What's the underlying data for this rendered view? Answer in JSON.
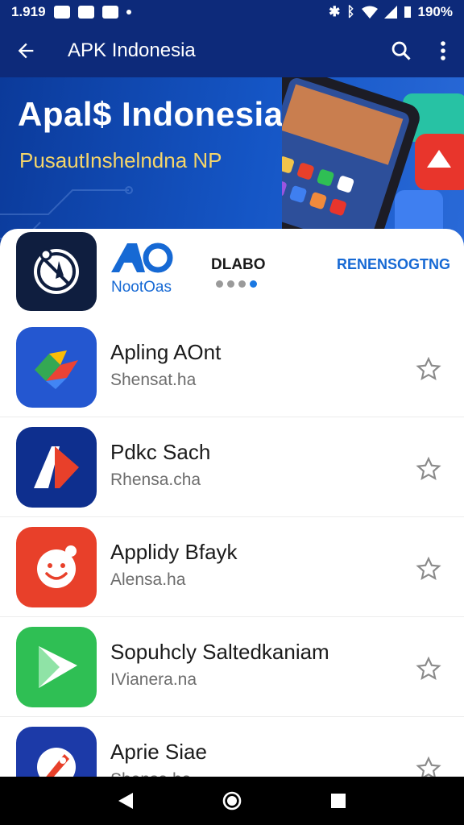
{
  "status_bar": {
    "time": "1.919",
    "battery": "190%"
  },
  "app_bar": {
    "title": "APK Indonesia",
    "icons": [
      "back-arrow-icon",
      "search-icon",
      "more-vert-icon"
    ]
  },
  "banner": {
    "headline": "Apal$ Indonesia",
    "subtitle": "PusautInshelndna NP"
  },
  "featured": {
    "brand_logo_text": "AO",
    "brand_name": "NootOas",
    "label": "DLABO",
    "link": "RENENSOGTNG",
    "page_dots": 4,
    "active_dot": 3
  },
  "apps": [
    {
      "name": "Apling AOnt",
      "desc": "Shensat.ha",
      "icon": "maps-icon",
      "color": "#2457d0"
    },
    {
      "name": "Pdkc Sach",
      "desc": "Rhensa.cha",
      "icon": "arrow-logo-icon",
      "color": "#0e2f8e"
    },
    {
      "name": "Applidy Bfayk",
      "desc": "Alensa.ha",
      "icon": "smile-face-icon",
      "color": "#e8402a"
    },
    {
      "name": "Sopuhcly Saltedkaniam",
      "desc": "IVianera.na",
      "icon": "play-icon",
      "color": "#2fbf54"
    },
    {
      "name": "Aprie Siae",
      "desc": "Shensa.ha",
      "icon": "rocket-icon",
      "color": "#1c3aa8"
    }
  ],
  "colors": {
    "primary": "#0d2a7a",
    "accent": "#1669d4",
    "banner_sub": "#f4d56a"
  }
}
